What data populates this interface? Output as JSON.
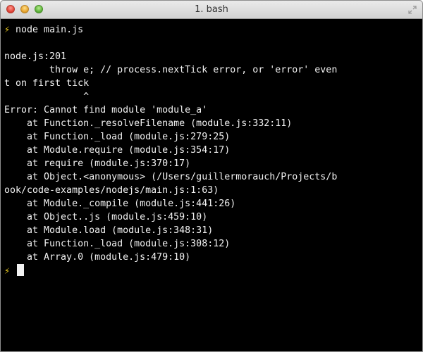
{
  "window": {
    "title": "1. bash"
  },
  "terminal": {
    "prompt_symbol": "⚡",
    "command": "node main.js",
    "output_lines": [
      "",
      "node.js:201",
      "        throw e; // process.nextTick error, or 'error' even",
      "t on first tick",
      "              ^",
      "Error: Cannot find module 'module_a'",
      "    at Function._resolveFilename (module.js:332:11)",
      "    at Function._load (module.js:279:25)",
      "    at Module.require (module.js:354:17)",
      "    at require (module.js:370:17)",
      "    at Object.<anonymous> (/Users/guillermorauch/Projects/b",
      "ook/code-examples/nodejs/main.js:1:63)",
      "    at Module._compile (module.js:441:26)",
      "    at Object..js (module.js:459:10)",
      "    at Module.load (module.js:348:31)",
      "    at Function._load (module.js:308:12)",
      "    at Array.0 (module.js:479:10)"
    ]
  },
  "colors": {
    "background": "#000000",
    "text": "#f2f2f2",
    "prompt": "#f4d21f"
  },
  "icons": {
    "close": "close-button",
    "minimize": "minimize-button",
    "zoom": "zoom-button",
    "fullscreen": "fullscreen-icon"
  }
}
